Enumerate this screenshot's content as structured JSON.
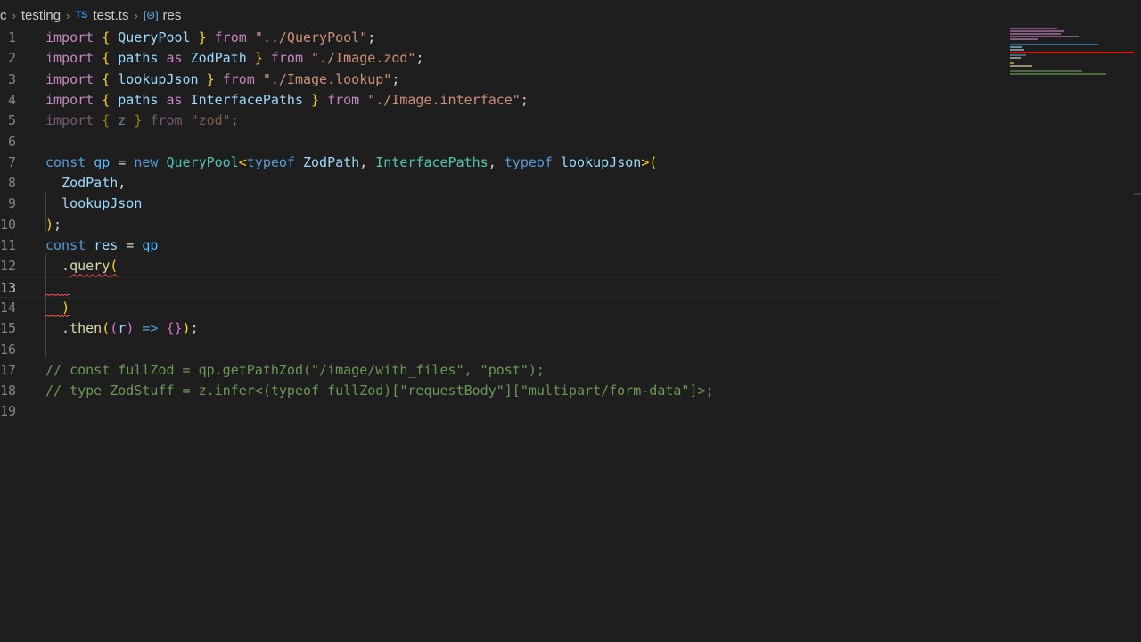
{
  "breadcrumb": {
    "items": [
      "c",
      "testing",
      "test.ts",
      "res"
    ],
    "ts_badge": "TS",
    "symbol_badge": "[⊝]"
  },
  "editor": {
    "lines": [
      {
        "n": "1",
        "tokens": [
          [
            "import",
            "kc"
          ],
          [
            " ",
            ""
          ],
          [
            "{",
            "b1"
          ],
          [
            " ",
            ""
          ],
          [
            "QueryPool",
            "var"
          ],
          [
            " ",
            ""
          ],
          [
            "}",
            "b1"
          ],
          [
            " ",
            ""
          ],
          [
            "from",
            "kc"
          ],
          [
            " ",
            ""
          ],
          [
            "\"../QueryPool\"",
            "str"
          ],
          [
            ";",
            ""
          ]
        ]
      },
      {
        "n": "2",
        "tokens": [
          [
            "import",
            "kc"
          ],
          [
            " ",
            ""
          ],
          [
            "{",
            "b1"
          ],
          [
            " ",
            ""
          ],
          [
            "paths",
            "var"
          ],
          [
            " ",
            ""
          ],
          [
            "as",
            "kc"
          ],
          [
            " ",
            ""
          ],
          [
            "ZodPath",
            "var"
          ],
          [
            " ",
            ""
          ],
          [
            "}",
            "b1"
          ],
          [
            " ",
            ""
          ],
          [
            "from",
            "kc"
          ],
          [
            " ",
            ""
          ],
          [
            "\"./Image.zod\"",
            "str"
          ],
          [
            ";",
            ""
          ]
        ]
      },
      {
        "n": "3",
        "tokens": [
          [
            "import",
            "kc"
          ],
          [
            " ",
            ""
          ],
          [
            "{",
            "b1"
          ],
          [
            " ",
            ""
          ],
          [
            "lookupJson",
            "var"
          ],
          [
            " ",
            ""
          ],
          [
            "}",
            "b1"
          ],
          [
            " ",
            ""
          ],
          [
            "from",
            "kc"
          ],
          [
            " ",
            ""
          ],
          [
            "\"./Image.lookup\"",
            "str"
          ],
          [
            ";",
            ""
          ]
        ]
      },
      {
        "n": "4",
        "tokens": [
          [
            "import",
            "kc"
          ],
          [
            " ",
            ""
          ],
          [
            "{",
            "b1"
          ],
          [
            " ",
            ""
          ],
          [
            "paths",
            "var"
          ],
          [
            " ",
            ""
          ],
          [
            "as",
            "kc"
          ],
          [
            " ",
            ""
          ],
          [
            "InterfacePaths",
            "var"
          ],
          [
            " ",
            ""
          ],
          [
            "}",
            "b1"
          ],
          [
            " ",
            ""
          ],
          [
            "from",
            "kc"
          ],
          [
            " ",
            ""
          ],
          [
            "\"./Image.interface\"",
            "str"
          ],
          [
            ";",
            ""
          ]
        ]
      },
      {
        "n": "5",
        "dim": true,
        "tokens": [
          [
            "import",
            "kc"
          ],
          [
            " ",
            ""
          ],
          [
            "{",
            "b1"
          ],
          [
            " ",
            ""
          ],
          [
            "z",
            "var"
          ],
          [
            " ",
            ""
          ],
          [
            "}",
            "b1"
          ],
          [
            " ",
            ""
          ],
          [
            "from",
            "kc"
          ],
          [
            " ",
            ""
          ],
          [
            "\"zod\"",
            "str"
          ],
          [
            ";",
            ""
          ]
        ]
      },
      {
        "n": "6",
        "tokens": []
      },
      {
        "n": "7",
        "tokens": [
          [
            "const",
            "kw"
          ],
          [
            " ",
            ""
          ],
          [
            "qp",
            "const"
          ],
          [
            " = ",
            ""
          ],
          [
            "new",
            "kw"
          ],
          [
            " ",
            ""
          ],
          [
            "QueryPool",
            "cls"
          ],
          [
            "<",
            "b1"
          ],
          [
            "typeof",
            "kw"
          ],
          [
            " ",
            ""
          ],
          [
            "ZodPath",
            "var"
          ],
          [
            ", ",
            ""
          ],
          [
            "InterfacePaths",
            "cls"
          ],
          [
            ", ",
            ""
          ],
          [
            "typeof",
            "kw"
          ],
          [
            " ",
            ""
          ],
          [
            "lookupJson",
            "var"
          ],
          [
            ">(",
            "b1"
          ]
        ]
      },
      {
        "n": "8",
        "tokens": [
          [
            "  ",
            ""
          ],
          [
            "ZodPath",
            "var"
          ],
          [
            ",",
            ""
          ]
        ]
      },
      {
        "n": "9",
        "tokens": [
          [
            "  ",
            ""
          ],
          [
            "lookupJson",
            "var"
          ]
        ]
      },
      {
        "n": "10",
        "tokens": [
          [
            ")",
            "b1"
          ],
          [
            ";",
            ""
          ]
        ]
      },
      {
        "n": "11",
        "tokens": [
          [
            "const",
            "kw"
          ],
          [
            " ",
            ""
          ],
          [
            "res",
            "var"
          ],
          [
            " = ",
            ""
          ],
          [
            "qp",
            "const"
          ]
        ]
      },
      {
        "n": "12",
        "tokens": [
          [
            "  .",
            ""
          ],
          [
            "query",
            "fn squig"
          ],
          [
            "(",
            "b1 squig"
          ]
        ]
      },
      {
        "n": "13",
        "current": true,
        "tokens": []
      },
      {
        "n": "14",
        "tokens": [
          [
            "  ",
            ""
          ],
          [
            ")",
            "b1"
          ]
        ]
      },
      {
        "n": "15",
        "tokens": [
          [
            "  .",
            ""
          ],
          [
            "then",
            "fn"
          ],
          [
            "(",
            "b1"
          ],
          [
            "(",
            "b2"
          ],
          [
            "r",
            "var"
          ],
          [
            ")",
            "b2"
          ],
          [
            " ",
            ""
          ],
          [
            "=>",
            "kw"
          ],
          [
            " ",
            ""
          ],
          [
            "{}",
            "b2"
          ],
          [
            ")",
            "b1"
          ],
          [
            ";",
            ""
          ]
        ]
      },
      {
        "n": "16",
        "tokens": []
      },
      {
        "n": "17",
        "tokens": [
          [
            "// const fullZod = qp.getPathZod(\"/image/with_files\", \"post\");",
            "cmt"
          ]
        ]
      },
      {
        "n": "18",
        "tokens": [
          [
            "// type ZodStuff = z.infer<(typeof fullZod)[\"requestBody\"][\"multipart/form-data\"]>;",
            "cmt"
          ]
        ]
      },
      {
        "n": "19",
        "tokens": []
      }
    ]
  },
  "colors": {
    "background": "#1e1e1e",
    "error": "#f14c4c",
    "keyword": "#569cd6",
    "control_keyword": "#c586c0",
    "string": "#ce9178",
    "variable": "#9cdcfe",
    "comment": "#6a9955"
  }
}
